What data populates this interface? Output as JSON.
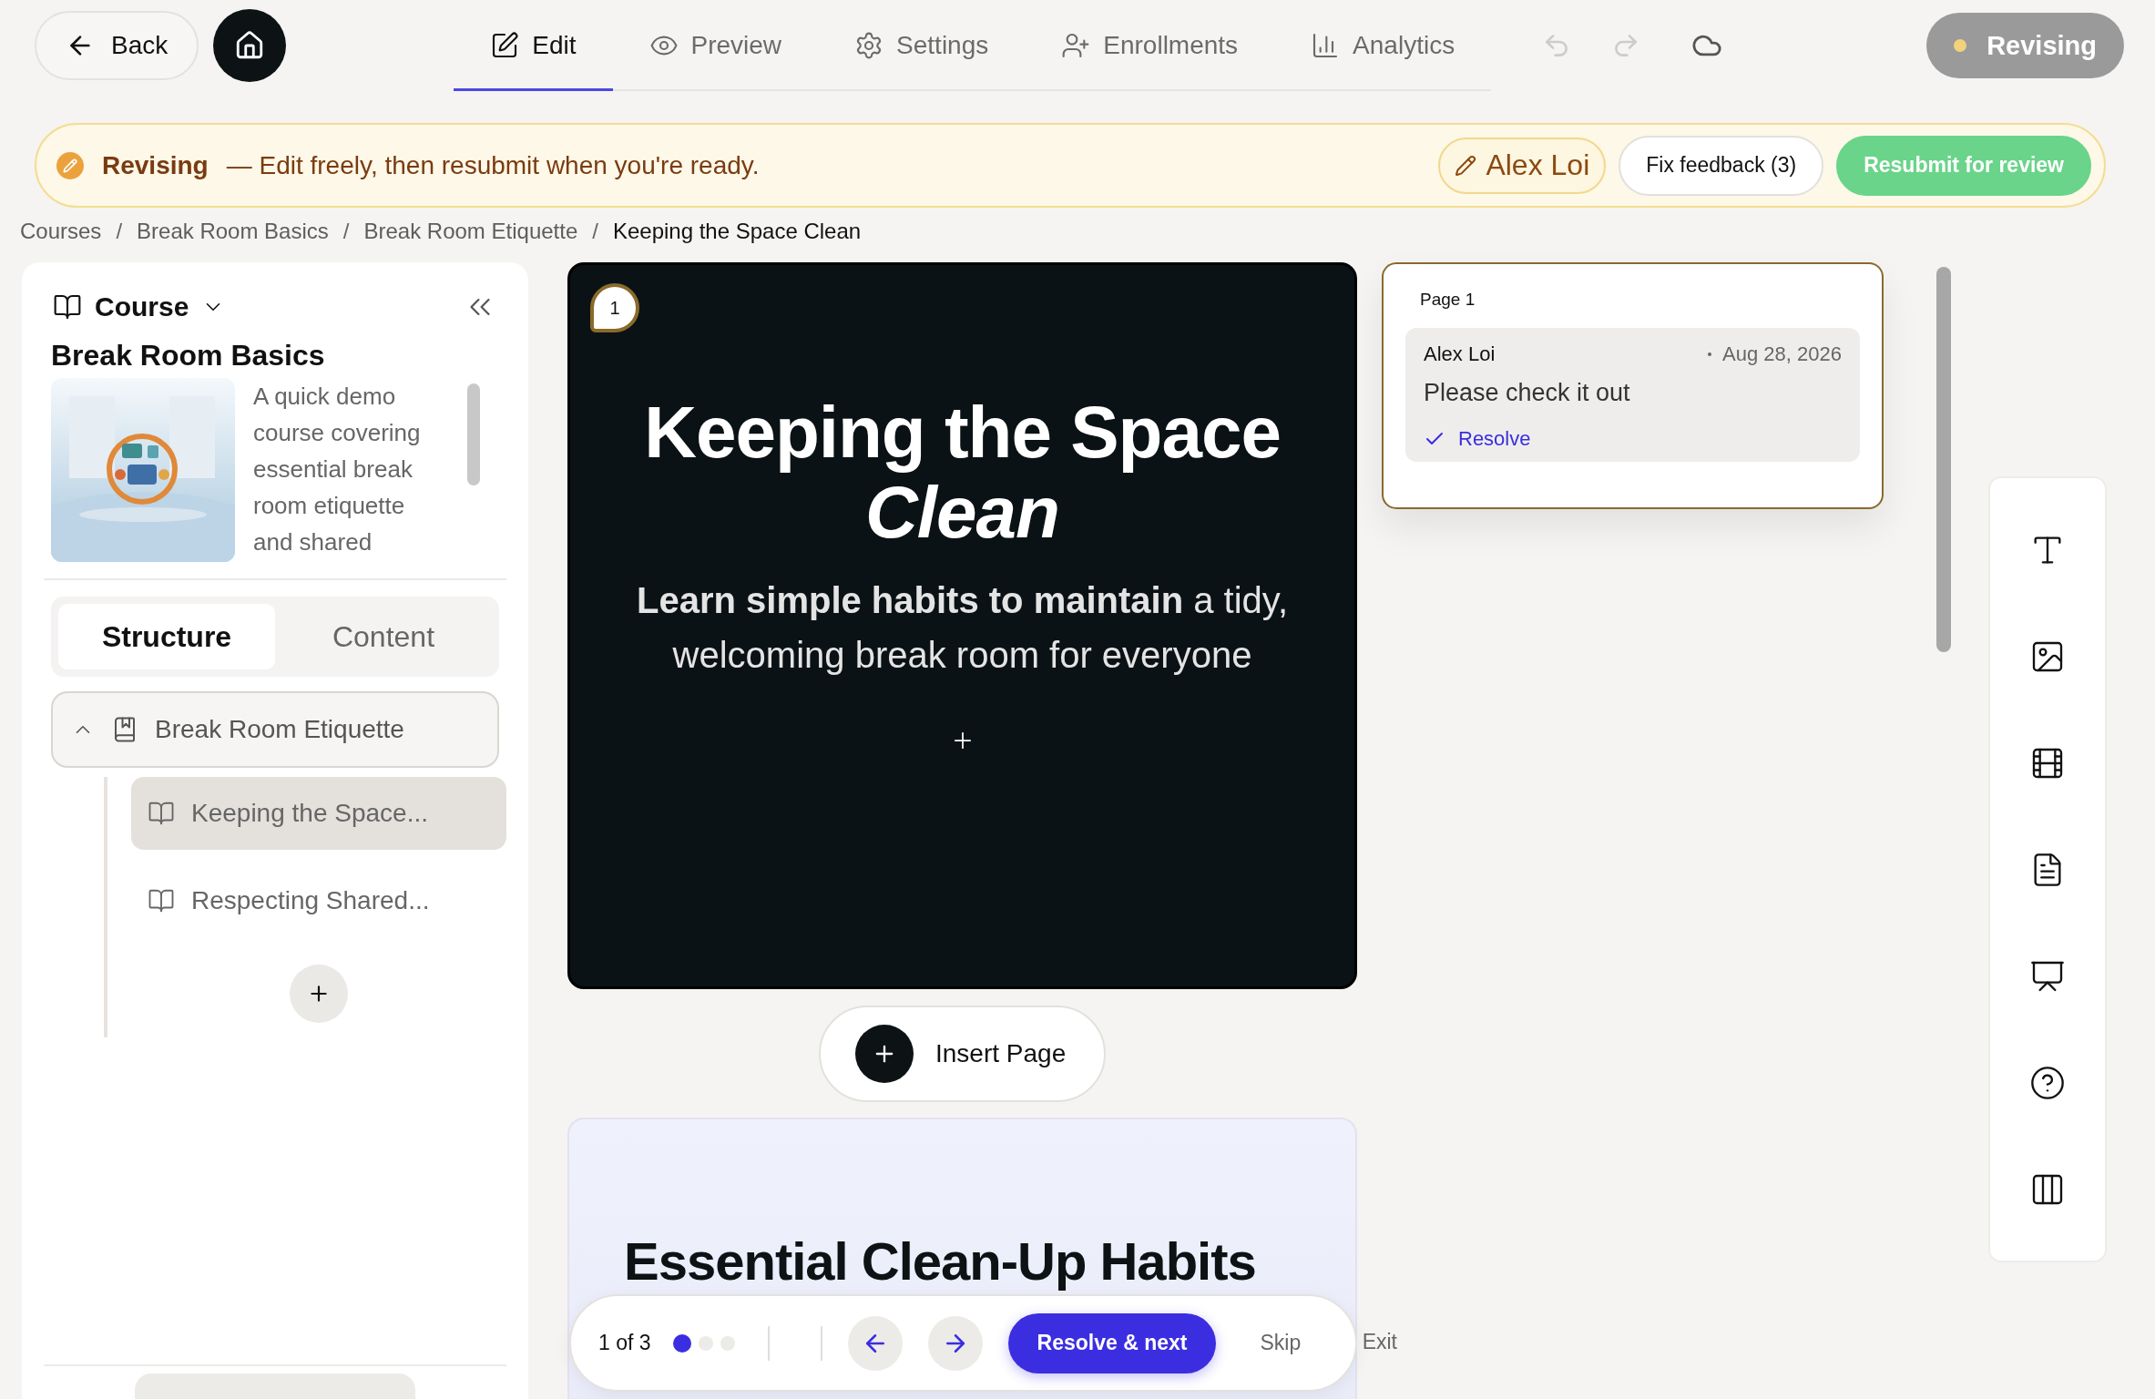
{
  "top_bar": {
    "back": "Back",
    "tabs": [
      {
        "label": "Edit",
        "selected": true
      },
      {
        "label": "Preview",
        "selected": false
      },
      {
        "label": "Settings",
        "selected": false
      },
      {
        "label": "Enrollments",
        "selected": false
      },
      {
        "label": "Analytics",
        "selected": false
      }
    ],
    "status": "Revising"
  },
  "banner": {
    "status": "Revising",
    "message": "— Edit freely, then resubmit when you're ready.",
    "user": "Alex Loi",
    "feedback_button": "Fix feedback (3)",
    "resubmit_button": "Resubmit for review"
  },
  "breadcrumb": {
    "separator": "/",
    "items": [
      "Courses",
      "Break Room Basics",
      "Break Room Etiquette",
      "Keeping the Space Clean"
    ]
  },
  "sidebar": {
    "mode": "Course",
    "course_title": "Break Room Basics",
    "description": "A quick demo course covering essential break room etiquette and shared",
    "tabs": [
      {
        "label": "Structure",
        "selected": true
      },
      {
        "label": "Content",
        "selected": false
      }
    ],
    "outline": [
      {
        "title": "Break Room Etiquette",
        "expanded": true,
        "children": [
          {
            "title": "Keeping the Space...",
            "selected": true
          },
          {
            "title": "Respecting Shared...",
            "selected": false
          }
        ]
      }
    ]
  },
  "slides": [
    {
      "kind": "title",
      "number": "1",
      "title": "Keeping the Space *Clean*",
      "subtitle": "**Learn simple habits to maintain** a tidy, welcoming break room for everyone"
    },
    {
      "kind": "content",
      "title": "Essential Clean-Up Habits"
    }
  ],
  "insert_page": "Insert Page",
  "comment": {
    "page": "Page 1",
    "author": "Alex Loi",
    "date": "Aug 28, 2026",
    "text": "Please check it out",
    "resolve": "Resolve"
  },
  "review_bar": {
    "counter": "1 of 3",
    "dots": [
      {
        "selected": true
      },
      {
        "selected": false
      },
      {
        "selected": false
      }
    ],
    "resolve_next": "Resolve & next",
    "skip": "Skip",
    "exit": "Exit"
  }
}
